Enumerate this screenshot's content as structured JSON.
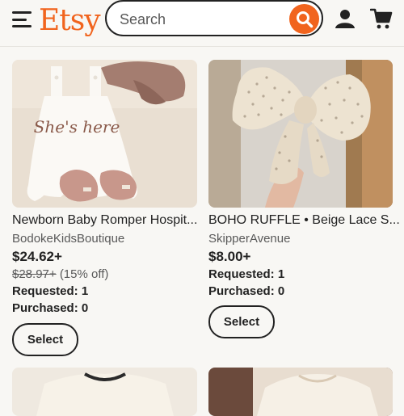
{
  "header": {
    "logo": "Etsy",
    "search_placeholder": "Search"
  },
  "listings": [
    {
      "title": "Newborn Baby Romper Hospit...",
      "shop": "BodokeKidsBoutique",
      "price": "$24.62+",
      "original_price": "$28.97+",
      "discount": "(15% off)",
      "requested": "Requested: 1",
      "purchased": "Purchased: 0",
      "select_label": "Select",
      "image_text": "She's here"
    },
    {
      "title": "BOHO RUFFLE • Beige Lace S...",
      "shop": "SkipperAvenue",
      "price": "$8.00+",
      "requested": "Requested: 1",
      "purchased": "Purchased: 0",
      "select_label": "Select"
    }
  ],
  "colors": {
    "brand": "#f1641e",
    "text": "#222222",
    "muted": "#595959",
    "background": "#f8f7f4"
  },
  "icons": [
    "menu-icon",
    "search-icon",
    "user-icon",
    "cart-icon"
  ]
}
